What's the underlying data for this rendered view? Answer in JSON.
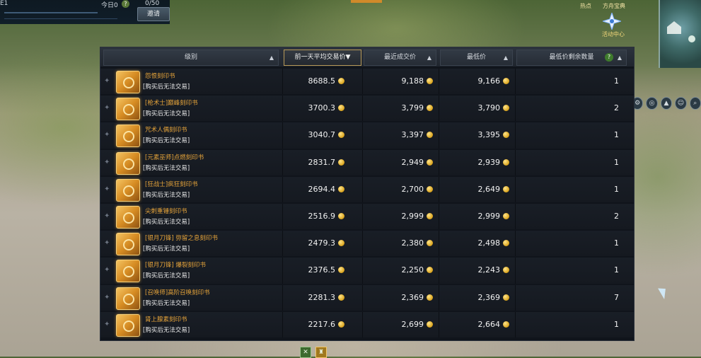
{
  "hud": {
    "left_top_fragment": "E1",
    "today_label": "今日0",
    "help_glyph": "?",
    "counter": "0/50",
    "invite_button": "邀请",
    "hot_label": "热点",
    "treasure_label": "方舟宝典",
    "event_center_label": "活动中心"
  },
  "market": {
    "columns": [
      {
        "label": "级别",
        "sort": "▲"
      },
      {
        "label": "前一天平均交易价",
        "sort": "▼"
      },
      {
        "label": "最近成交价",
        "sort": "▲"
      },
      {
        "label": "最低价",
        "sort": "▲"
      },
      {
        "label": "最低价剩余数量",
        "sort": "▲",
        "help": "?"
      }
    ],
    "rows": [
      {
        "name": "怨恨刻印书",
        "status": "[购买后无法交易]",
        "avg": "8688.5",
        "recent": "9,188",
        "lowest": "9,166",
        "qty": "1"
      },
      {
        "name": "[枪术士]巅峰刻印书",
        "status": "[购买后无法交易]",
        "avg": "3700.3",
        "recent": "3,799",
        "lowest": "3,790",
        "qty": "2"
      },
      {
        "name": "咒术人偶刻印书",
        "status": "[购买后无法交易]",
        "avg": "3040.7",
        "recent": "3,397",
        "lowest": "3,395",
        "qty": "1"
      },
      {
        "name": "[元素巫师]点燃刻印书",
        "status": "[购买后无法交易]",
        "avg": "2831.7",
        "recent": "2,949",
        "lowest": "2,939",
        "qty": "1"
      },
      {
        "name": "[狂战士]疯狂刻印书",
        "status": "[购买后无法交易]",
        "avg": "2694.4",
        "recent": "2,700",
        "lowest": "2,649",
        "qty": "1"
      },
      {
        "name": "尖刺重锤刻印书",
        "status": "[购买后无法交易]",
        "avg": "2516.9",
        "recent": "2,999",
        "lowest": "2,999",
        "qty": "2"
      },
      {
        "name": "[银月刀锋] 弥留之息刻印书",
        "status": "[购买后无法交易]",
        "avg": "2479.3",
        "recent": "2,380",
        "lowest": "2,498",
        "qty": "1"
      },
      {
        "name": "[银月刀锋] 爆裂刻印书",
        "status": "[购买后无法交易]",
        "avg": "2376.5",
        "recent": "2,250",
        "lowest": "2,243",
        "qty": "1"
      },
      {
        "name": "[召唤师]高阶召唤刻印书",
        "status": "[购买后无法交易]",
        "avg": "2281.3",
        "recent": "2,369",
        "lowest": "2,369",
        "qty": "7"
      },
      {
        "name": "肾上腺素刻印书",
        "status": "[购买后无法交易]",
        "avg": "2217.6",
        "recent": "2,699",
        "lowest": "2,664",
        "qty": "1"
      }
    ]
  },
  "icons": {
    "pin": "pin-icon",
    "book": "engraving-book-icon",
    "coin": "gold-coin-icon"
  }
}
